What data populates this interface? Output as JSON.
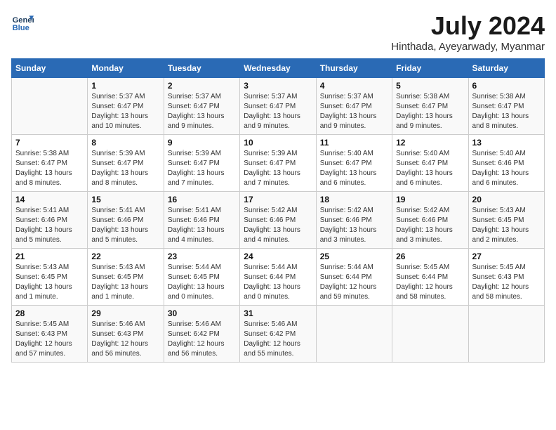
{
  "header": {
    "logo_line1": "General",
    "logo_line2": "Blue",
    "title": "July 2024",
    "subtitle": "Hinthada, Ayeyarwady, Myanmar"
  },
  "weekdays": [
    "Sunday",
    "Monday",
    "Tuesday",
    "Wednesday",
    "Thursday",
    "Friday",
    "Saturday"
  ],
  "weeks": [
    [
      {
        "day": "",
        "info": ""
      },
      {
        "day": "1",
        "info": "Sunrise: 5:37 AM\nSunset: 6:47 PM\nDaylight: 13 hours\nand 10 minutes."
      },
      {
        "day": "2",
        "info": "Sunrise: 5:37 AM\nSunset: 6:47 PM\nDaylight: 13 hours\nand 9 minutes."
      },
      {
        "day": "3",
        "info": "Sunrise: 5:37 AM\nSunset: 6:47 PM\nDaylight: 13 hours\nand 9 minutes."
      },
      {
        "day": "4",
        "info": "Sunrise: 5:37 AM\nSunset: 6:47 PM\nDaylight: 13 hours\nand 9 minutes."
      },
      {
        "day": "5",
        "info": "Sunrise: 5:38 AM\nSunset: 6:47 PM\nDaylight: 13 hours\nand 9 minutes."
      },
      {
        "day": "6",
        "info": "Sunrise: 5:38 AM\nSunset: 6:47 PM\nDaylight: 13 hours\nand 8 minutes."
      }
    ],
    [
      {
        "day": "7",
        "info": "Sunrise: 5:38 AM\nSunset: 6:47 PM\nDaylight: 13 hours\nand 8 minutes."
      },
      {
        "day": "8",
        "info": "Sunrise: 5:39 AM\nSunset: 6:47 PM\nDaylight: 13 hours\nand 8 minutes."
      },
      {
        "day": "9",
        "info": "Sunrise: 5:39 AM\nSunset: 6:47 PM\nDaylight: 13 hours\nand 7 minutes."
      },
      {
        "day": "10",
        "info": "Sunrise: 5:39 AM\nSunset: 6:47 PM\nDaylight: 13 hours\nand 7 minutes."
      },
      {
        "day": "11",
        "info": "Sunrise: 5:40 AM\nSunset: 6:47 PM\nDaylight: 13 hours\nand 6 minutes."
      },
      {
        "day": "12",
        "info": "Sunrise: 5:40 AM\nSunset: 6:47 PM\nDaylight: 13 hours\nand 6 minutes."
      },
      {
        "day": "13",
        "info": "Sunrise: 5:40 AM\nSunset: 6:46 PM\nDaylight: 13 hours\nand 6 minutes."
      }
    ],
    [
      {
        "day": "14",
        "info": "Sunrise: 5:41 AM\nSunset: 6:46 PM\nDaylight: 13 hours\nand 5 minutes."
      },
      {
        "day": "15",
        "info": "Sunrise: 5:41 AM\nSunset: 6:46 PM\nDaylight: 13 hours\nand 5 minutes."
      },
      {
        "day": "16",
        "info": "Sunrise: 5:41 AM\nSunset: 6:46 PM\nDaylight: 13 hours\nand 4 minutes."
      },
      {
        "day": "17",
        "info": "Sunrise: 5:42 AM\nSunset: 6:46 PM\nDaylight: 13 hours\nand 4 minutes."
      },
      {
        "day": "18",
        "info": "Sunrise: 5:42 AM\nSunset: 6:46 PM\nDaylight: 13 hours\nand 3 minutes."
      },
      {
        "day": "19",
        "info": "Sunrise: 5:42 AM\nSunset: 6:46 PM\nDaylight: 13 hours\nand 3 minutes."
      },
      {
        "day": "20",
        "info": "Sunrise: 5:43 AM\nSunset: 6:45 PM\nDaylight: 13 hours\nand 2 minutes."
      }
    ],
    [
      {
        "day": "21",
        "info": "Sunrise: 5:43 AM\nSunset: 6:45 PM\nDaylight: 13 hours\nand 1 minute."
      },
      {
        "day": "22",
        "info": "Sunrise: 5:43 AM\nSunset: 6:45 PM\nDaylight: 13 hours\nand 1 minute."
      },
      {
        "day": "23",
        "info": "Sunrise: 5:44 AM\nSunset: 6:45 PM\nDaylight: 13 hours\nand 0 minutes."
      },
      {
        "day": "24",
        "info": "Sunrise: 5:44 AM\nSunset: 6:44 PM\nDaylight: 13 hours\nand 0 minutes."
      },
      {
        "day": "25",
        "info": "Sunrise: 5:44 AM\nSunset: 6:44 PM\nDaylight: 12 hours\nand 59 minutes."
      },
      {
        "day": "26",
        "info": "Sunrise: 5:45 AM\nSunset: 6:44 PM\nDaylight: 12 hours\nand 58 minutes."
      },
      {
        "day": "27",
        "info": "Sunrise: 5:45 AM\nSunset: 6:43 PM\nDaylight: 12 hours\nand 58 minutes."
      }
    ],
    [
      {
        "day": "28",
        "info": "Sunrise: 5:45 AM\nSunset: 6:43 PM\nDaylight: 12 hours\nand 57 minutes."
      },
      {
        "day": "29",
        "info": "Sunrise: 5:46 AM\nSunset: 6:43 PM\nDaylight: 12 hours\nand 56 minutes."
      },
      {
        "day": "30",
        "info": "Sunrise: 5:46 AM\nSunset: 6:42 PM\nDaylight: 12 hours\nand 56 minutes."
      },
      {
        "day": "31",
        "info": "Sunrise: 5:46 AM\nSunset: 6:42 PM\nDaylight: 12 hours\nand 55 minutes."
      },
      {
        "day": "",
        "info": ""
      },
      {
        "day": "",
        "info": ""
      },
      {
        "day": "",
        "info": ""
      }
    ]
  ]
}
